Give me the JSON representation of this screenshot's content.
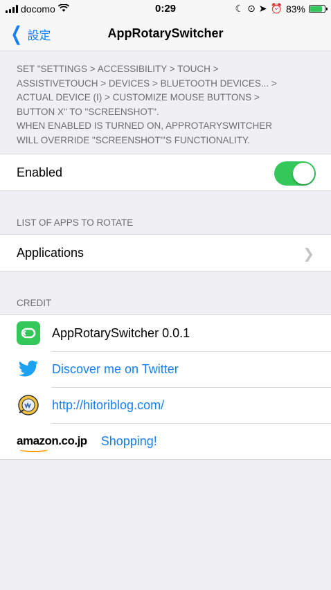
{
  "status_bar": {
    "carrier": "docomo",
    "time": "0:29",
    "battery": "83%"
  },
  "nav": {
    "back_label": "設定",
    "title": "AppRotarySwitcher"
  },
  "note": {
    "lines": [
      "SET \"SETTINGS > ACCESSIBILITY > TOUCH >",
      "ASSISTIVETOUCH > DEVICES > BLUETOOTH DEVICES... >",
      "ACTUAL DEVICE (I) > CUSTOMIZE MOUSE BUTTONS >",
      "BUTTON X\" TO \"SCREENSHOT\".",
      "WHEN ENABLED IS TURNED ON, APPROTARYSWITCHER",
      "WILL OVERRIDE \"SCREENSHOT\"'S FUNCTIONALITY."
    ]
  },
  "enabled": {
    "label": "Enabled",
    "on": true
  },
  "apps_section": {
    "header": "LIST OF APPS TO ROTATE",
    "applications_label": "Applications"
  },
  "credit_section": {
    "header": "CREDIT",
    "version": "AppRotarySwitcher 0.0.1",
    "twitter": "Discover me on Twitter",
    "blog": "http://hitoriblog.com/",
    "amazon_logo": "amazon.co.jp",
    "shopping": "Shopping!"
  },
  "colors": {
    "accent": "#157efb",
    "toggle_on": "#34c759",
    "app_icon_green": "#34c759",
    "twitter_blue": "#1da1f2"
  }
}
